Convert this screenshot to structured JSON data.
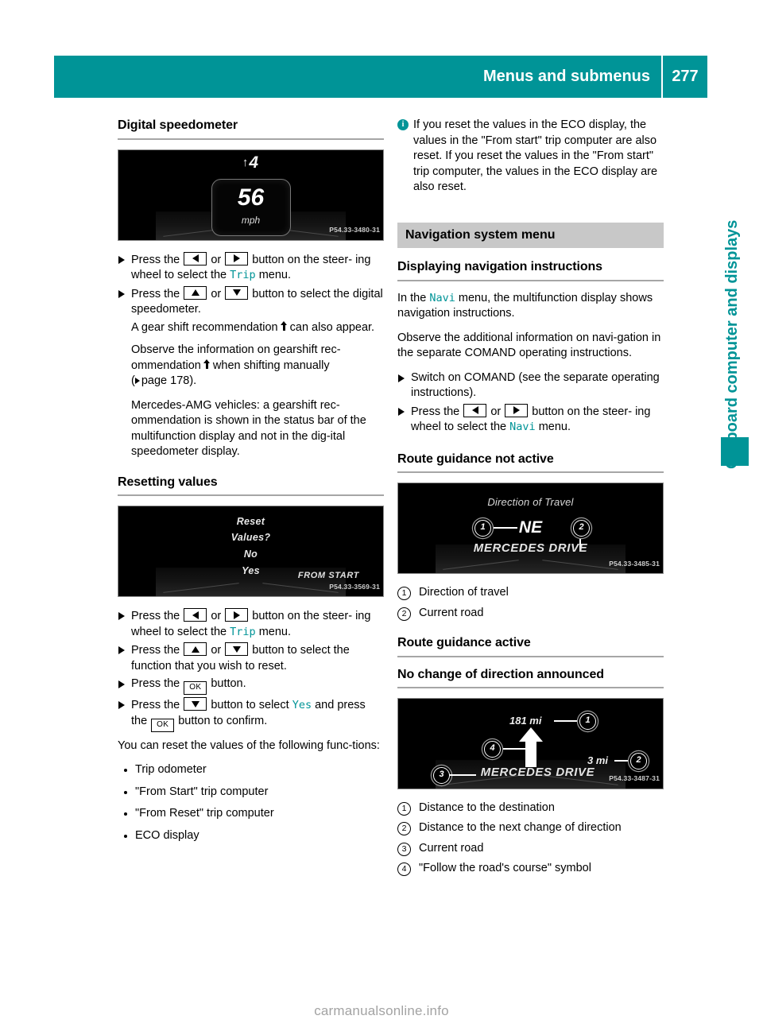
{
  "header": {
    "title": "Menus and submenus",
    "page_number": "277",
    "accent_color": "#009497"
  },
  "side_tab": {
    "label": "On-board computer and displays"
  },
  "left_column": {
    "section1": {
      "heading": "Digital speedometer",
      "figure": {
        "gear_indicator": "4",
        "speed_value": "56",
        "speed_unit": "mph",
        "caption": "P54.33-3480-31"
      },
      "steps": [
        {
          "prefix": "Press the",
          "key1": "left-arrow",
          "or": "or",
          "key2": "right-arrow",
          "middle": "button on the steer-",
          "line2_before": "ing wheel to select the",
          "mfd_word": "Trip",
          "line2_after": "menu."
        },
        {
          "prefix": "Press the",
          "key1": "up-arrow",
          "or": "or",
          "key2": "down-arrow",
          "middle": "button to select the",
          "line2": "digital speedometer."
        }
      ],
      "sub_lines": [
        "A gear shift recommendation",
        "can also",
        "appear."
      ],
      "paragraphs": [
        {
          "p1": "Observe the information on gearshift rec-",
          "p2": "ommendation",
          "p3": "when shifting manually",
          "page_ref": "page 178)."
        },
        {
          "text": "Mercedes-AMG vehicles: a gearshift rec-ommendation is shown in the status bar of the multifunction display and not in the dig-ital speedometer display."
        }
      ]
    },
    "section2": {
      "heading": "Resetting values",
      "figure": {
        "line1": "Reset",
        "line2": "Values?",
        "line3": "No",
        "line4": "Yes",
        "from_start": "FROM START",
        "caption": "P54.33-3569-31"
      },
      "steps": [
        {
          "prefix": "Press the",
          "key1": "left-arrow",
          "or": "or",
          "key2": "right-arrow",
          "middle": "button on the steer-",
          "line2_before": "ing wheel to select the",
          "mfd_word": "Trip",
          "line2_after": "menu."
        },
        {
          "prefix": "Press the",
          "key1": "up-arrow",
          "or": "or",
          "key2": "down-arrow",
          "middle": "button to select the",
          "line2": "function that you wish to reset."
        },
        {
          "prefix": "Press the",
          "key1": "OK",
          "middle": "button."
        },
        {
          "prefix": "Press the",
          "key1": "down-arrow",
          "middle": "button to select",
          "mfd_word": "Yes",
          "after": "and",
          "line2_before": "press the",
          "key2": "OK",
          "line2_after": "button to confirm."
        }
      ],
      "closing_paragraph": "You can reset the values of the following func-tions:",
      "bullets": [
        "Trip odometer",
        "\"From Start\" trip computer",
        "\"From Reset\" trip computer",
        "ECO display"
      ]
    }
  },
  "right_column": {
    "info_note": "If you reset the values in the ECO display, the values in the \"From start\" trip computer are also reset. If you reset the values in the \"From start\" trip computer, the values in the ECO display are also reset.",
    "band_heading": "Navigation system menu",
    "section1": {
      "heading": "Displaying navigation instructions",
      "para1_before": "In the",
      "para1_mfd": "Navi",
      "para1_after": "menu, the multifunction display shows navigation instructions.",
      "para2": "Observe the additional information on navi-gation in the separate COMAND operating instructions.",
      "steps": [
        {
          "text": "Switch on COMAND (see the separate operating instructions)."
        },
        {
          "prefix": "Press the",
          "key1": "left-arrow",
          "or": "or",
          "key2": "right-arrow",
          "middle": "button on the steer-",
          "line2_before": "ing wheel to select the",
          "mfd_word": "Navi",
          "line2_after": "menu."
        }
      ]
    },
    "section2": {
      "heading": "Route guidance not active",
      "figure": {
        "title": "Direction of Travel",
        "direction": "NE",
        "road": "MERCEDES DRIVE",
        "callout1": "1",
        "callout2": "2",
        "caption": "P54.33-3485-31"
      },
      "legend": [
        {
          "num": "1",
          "text": "Direction of travel"
        },
        {
          "num": "2",
          "text": "Current road"
        }
      ]
    },
    "section3": {
      "heading": "Route guidance active",
      "subheading": "No change of direction announced",
      "figure": {
        "distance_destination": "181 mi",
        "distance_next": "3 mi",
        "road": "MERCEDES DRIVE",
        "callout1": "1",
        "callout2": "2",
        "callout3": "3",
        "callout4": "4",
        "caption": "P54.33-3487-31"
      },
      "legend": [
        {
          "num": "1",
          "text": "Distance to the destination"
        },
        {
          "num": "2",
          "text": "Distance to the next change of direction"
        },
        {
          "num": "3",
          "text": "Current road"
        },
        {
          "num": "4",
          "text": "\"Follow the road's course\" symbol"
        }
      ]
    }
  },
  "footer": {
    "watermark": "carmanualsonline.info"
  }
}
